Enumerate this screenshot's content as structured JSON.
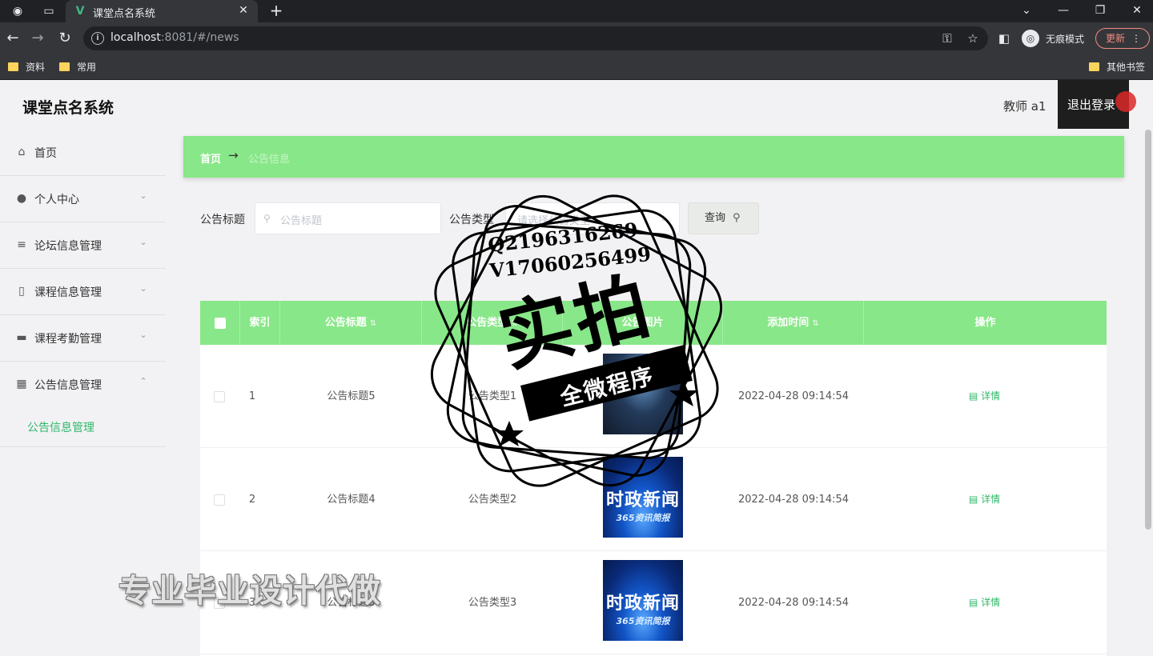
{
  "browser": {
    "tab_title": "课堂点名系统",
    "url_host": "localhost",
    "url_rest": ":8081/#/news",
    "incognito_label": "无痕模式",
    "update_label": "更新",
    "bookmarks": [
      "资料",
      "常用"
    ],
    "other_bookmarks": "其他书签"
  },
  "app": {
    "title": "课堂点名系统",
    "user": "教师 a1",
    "logout": "退出登录"
  },
  "sidebar": {
    "items": [
      {
        "label": "首页",
        "icon": "home-icon"
      },
      {
        "label": "个人中心",
        "icon": "user-icon"
      },
      {
        "label": "论坛信息管理",
        "icon": "list-icon"
      },
      {
        "label": "课程信息管理",
        "icon": "phone-icon"
      },
      {
        "label": "课程考勤管理",
        "icon": "briefcase-icon"
      },
      {
        "label": "公告信息管理",
        "icon": "grid-icon"
      }
    ],
    "active_sub": "公告信息管理"
  },
  "breadcrumb": {
    "home": "首页",
    "separator": "→",
    "current": "公告信息"
  },
  "search": {
    "title_label": "公告标题",
    "title_placeholder": "公告标题",
    "type_label": "公告类型",
    "type_placeholder": "请选择公告类型",
    "query_button": "查询"
  },
  "table": {
    "headers": [
      "索引",
      "公告标题",
      "公告类型",
      "公告图片",
      "添加时间",
      "操作"
    ],
    "rows": [
      {
        "index": "1",
        "title": "公告标题5",
        "type": "公告类型1",
        "time": "2022-04-28 09:14:54",
        "action": "详情"
      },
      {
        "index": "2",
        "title": "公告标题4",
        "type": "公告类型2",
        "time": "2022-04-28 09:14:54",
        "action": "详情"
      },
      {
        "index": "3",
        "title": "公告标题3",
        "type": "公告类型3",
        "time": "2022-04-28 09:14:54",
        "action": "详情"
      }
    ],
    "image_title": "时政新闻",
    "image_subtitle": "365资讯简报"
  },
  "overlay": {
    "stamp_q": "Q2196316269",
    "stamp_v": "V17060256499",
    "stamp_big": "实拍",
    "stamp_banner": "全微程序",
    "watermark": "专业毕业设计代做"
  },
  "colors": {
    "accent_green": "#88e788",
    "link_green": "#2fb86a"
  }
}
